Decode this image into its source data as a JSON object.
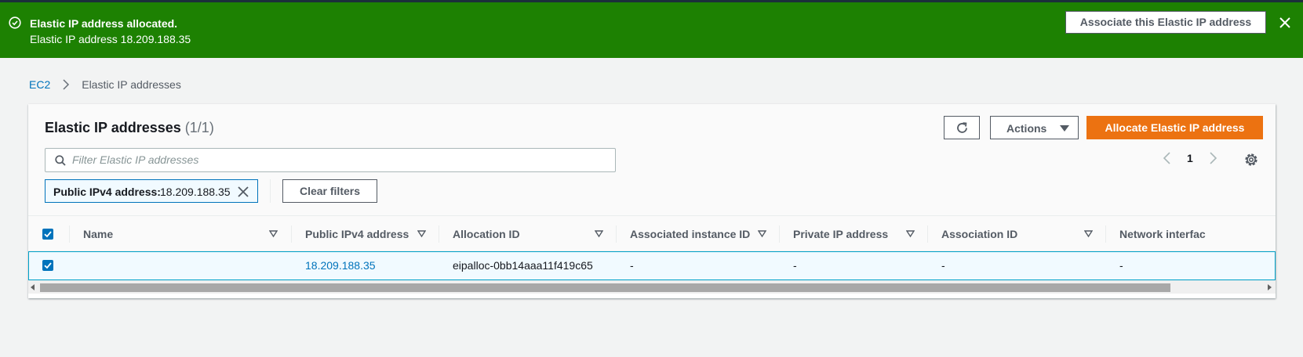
{
  "flash": {
    "title": "Elastic IP address allocated.",
    "message": "Elastic IP address 18.209.188.35",
    "action_label": "Associate this Elastic IP address",
    "icon": "success-check-icon",
    "color": "#1d8102"
  },
  "breadcrumb": {
    "root": "EC2",
    "current": "Elastic IP addresses"
  },
  "panel": {
    "title": "Elastic IP addresses",
    "count": "(1/1)"
  },
  "toolbar": {
    "actions_label": "Actions",
    "allocate_label": "Allocate Elastic IP address",
    "accent": "#ec7211"
  },
  "search": {
    "placeholder": "Filter Elastic IP addresses",
    "value": ""
  },
  "pagination": {
    "page": "1"
  },
  "filter_token": {
    "key": "Public IPv4 address:",
    "value": "18.209.188.35"
  },
  "clear_filters_label": "Clear filters",
  "table": {
    "columns": [
      "Name",
      "Public IPv4 address",
      "Allocation ID",
      "Associated instance ID",
      "Private IP address",
      "Association ID",
      "Network interfac"
    ],
    "rows": [
      {
        "selected": true,
        "name": "",
        "public_ip": "18.209.188.35",
        "allocation_id": "eipalloc-0bb14aaa11f419c65",
        "instance_id": "-",
        "private_ip": "-",
        "association_id": "-",
        "network_interface": "-"
      }
    ]
  }
}
